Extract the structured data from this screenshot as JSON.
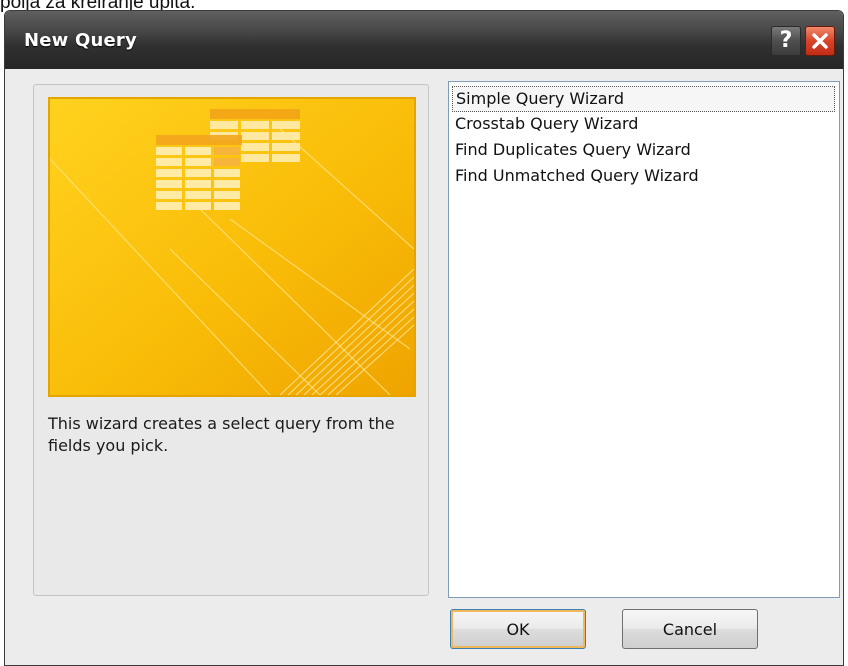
{
  "background": {
    "caption_fragment": "polja za kreiranje upita."
  },
  "dialog": {
    "title": "New Query",
    "help_glyph": "?",
    "help_icon": "question-mark-icon",
    "close_icon": "close-x-icon",
    "preview_icon": "query-wizard-table-illustration",
    "description": "This wizard creates a select query from the fields you pick.",
    "wizards": [
      {
        "label": "Simple Query Wizard",
        "selected": true
      },
      {
        "label": "Crosstab Query Wizard",
        "selected": false
      },
      {
        "label": "Find Duplicates Query Wizard",
        "selected": false
      },
      {
        "label": "Find Unmatched Query Wizard",
        "selected": false
      }
    ],
    "ok_label": "OK",
    "cancel_label": "Cancel"
  },
  "colors": {
    "titlebar": "#2e2e2e",
    "close_button": "#d8442a",
    "preview_gold": "#f7b500",
    "default_button_border": "#3c7fb1",
    "default_button_glow": "#f1b85b"
  }
}
